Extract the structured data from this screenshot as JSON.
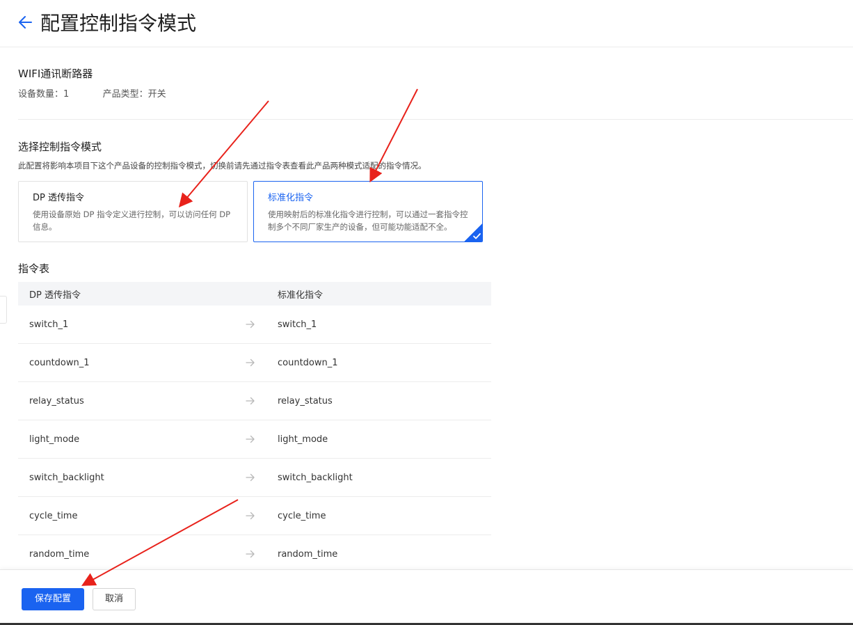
{
  "header": {
    "title": "配置控制指令模式",
    "back_icon": "arrow-left-icon"
  },
  "product": {
    "name": "WIFI通讯断路器",
    "device_count_label": "设备数量：",
    "device_count": "1",
    "product_type_label": "产品类型：",
    "product_type": "开关"
  },
  "mode_section": {
    "title": "选择控制指令模式",
    "description": "此配置将影响本项目下这个产品设备的控制指令模式，切换前请先通过指令表查看此产品两种模式适配的指令情况。",
    "options": [
      {
        "title": "DP 透传指令",
        "description": "使用设备原始 DP 指令定义进行控制，可以访问任何 DP 信息。",
        "selected": false
      },
      {
        "title": "标准化指令",
        "description": "使用映射后的标准化指令进行控制，可以通过一套指令控制多个不同厂家生产的设备，但可能功能适配不全。",
        "selected": true
      }
    ]
  },
  "command_table": {
    "title": "指令表",
    "columns": [
      "DP 透传指令",
      "标准化指令"
    ],
    "rows": [
      {
        "dp": "switch_1",
        "std": "switch_1"
      },
      {
        "dp": "countdown_1",
        "std": "countdown_1"
      },
      {
        "dp": "relay_status",
        "std": "relay_status"
      },
      {
        "dp": "light_mode",
        "std": "light_mode"
      },
      {
        "dp": "switch_backlight",
        "std": "switch_backlight"
      },
      {
        "dp": "cycle_time",
        "std": "cycle_time"
      },
      {
        "dp": "random_time",
        "std": "random_time"
      }
    ],
    "arrow_icon": "arrow-right-icon"
  },
  "footer": {
    "save_label": "保存配置",
    "cancel_label": "取消"
  },
  "colors": {
    "primary": "#1a63f0",
    "annotation": "#e8221b"
  }
}
